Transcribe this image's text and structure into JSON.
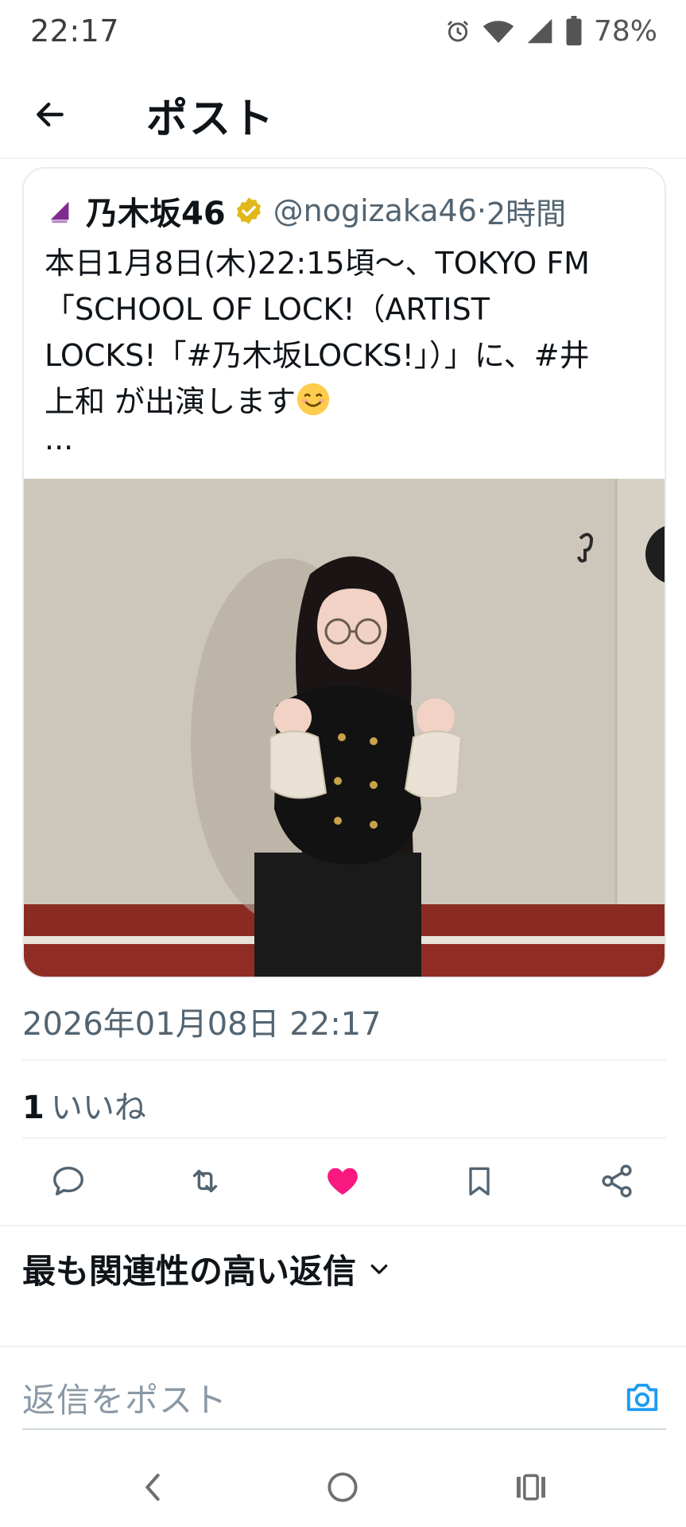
{
  "status_bar": {
    "time": "22:17",
    "battery": "78%",
    "icons": [
      "alarm-icon",
      "wifi-icon",
      "signal-icon",
      "battery-icon"
    ]
  },
  "header": {
    "title": "ポスト",
    "back_icon": "arrow-left-icon"
  },
  "post": {
    "author_name": "乃木坂46",
    "author_handle": "@nogizaka46",
    "separator": " · ",
    "relative_time": "2時間",
    "text_lines": [
      "本日1月8日(木)22:15頃〜、TOKYO FM",
      "「SCHOOL OF LOCK!（ARTIST",
      "LOCKS!「#乃木坂LOCKS!」）」に、#井",
      "上和 が出演します"
    ],
    "more": "...",
    "photo_icon": "photo-image"
  },
  "timestamp": "2026年01月08日 22:17",
  "likes": {
    "count": "1",
    "label": "いいね"
  },
  "actions": [
    {
      "name": "reply",
      "icon": "comment-icon"
    },
    {
      "name": "repost",
      "icon": "repost-icon"
    },
    {
      "name": "like",
      "icon": "heart-icon",
      "active": true
    },
    {
      "name": "bookmark",
      "icon": "bookmark-icon"
    },
    {
      "name": "share",
      "icon": "share-icon"
    }
  ],
  "replies": {
    "sort_label": "最も関連性の高い返信",
    "reply_placeholder": "返信をポスト"
  },
  "colors": {
    "like_active": "#f91880",
    "accent_blue": "#1d9bf0",
    "verified_gold": "#e2b719",
    "muted_text": "#536471",
    "brand_purple": "#7e2d8f"
  },
  "nav_bar": {
    "icons": [
      "nav-back-icon",
      "nav-home-icon",
      "nav-recents-icon"
    ]
  }
}
